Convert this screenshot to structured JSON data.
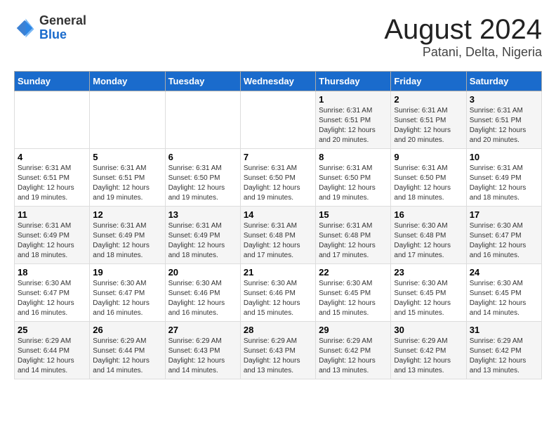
{
  "header": {
    "logo_general": "General",
    "logo_blue": "Blue",
    "main_title": "August 2024",
    "subtitle": "Patani, Delta, Nigeria"
  },
  "days_of_week": [
    "Sunday",
    "Monday",
    "Tuesday",
    "Wednesday",
    "Thursday",
    "Friday",
    "Saturday"
  ],
  "weeks": [
    [
      {
        "day": "",
        "info": ""
      },
      {
        "day": "",
        "info": ""
      },
      {
        "day": "",
        "info": ""
      },
      {
        "day": "",
        "info": ""
      },
      {
        "day": "1",
        "info": "Sunrise: 6:31 AM\nSunset: 6:51 PM\nDaylight: 12 hours\nand 20 minutes."
      },
      {
        "day": "2",
        "info": "Sunrise: 6:31 AM\nSunset: 6:51 PM\nDaylight: 12 hours\nand 20 minutes."
      },
      {
        "day": "3",
        "info": "Sunrise: 6:31 AM\nSunset: 6:51 PM\nDaylight: 12 hours\nand 20 minutes."
      }
    ],
    [
      {
        "day": "4",
        "info": "Sunrise: 6:31 AM\nSunset: 6:51 PM\nDaylight: 12 hours\nand 19 minutes."
      },
      {
        "day": "5",
        "info": "Sunrise: 6:31 AM\nSunset: 6:51 PM\nDaylight: 12 hours\nand 19 minutes."
      },
      {
        "day": "6",
        "info": "Sunrise: 6:31 AM\nSunset: 6:50 PM\nDaylight: 12 hours\nand 19 minutes."
      },
      {
        "day": "7",
        "info": "Sunrise: 6:31 AM\nSunset: 6:50 PM\nDaylight: 12 hours\nand 19 minutes."
      },
      {
        "day": "8",
        "info": "Sunrise: 6:31 AM\nSunset: 6:50 PM\nDaylight: 12 hours\nand 19 minutes."
      },
      {
        "day": "9",
        "info": "Sunrise: 6:31 AM\nSunset: 6:50 PM\nDaylight: 12 hours\nand 18 minutes."
      },
      {
        "day": "10",
        "info": "Sunrise: 6:31 AM\nSunset: 6:49 PM\nDaylight: 12 hours\nand 18 minutes."
      }
    ],
    [
      {
        "day": "11",
        "info": "Sunrise: 6:31 AM\nSunset: 6:49 PM\nDaylight: 12 hours\nand 18 minutes."
      },
      {
        "day": "12",
        "info": "Sunrise: 6:31 AM\nSunset: 6:49 PM\nDaylight: 12 hours\nand 18 minutes."
      },
      {
        "day": "13",
        "info": "Sunrise: 6:31 AM\nSunset: 6:49 PM\nDaylight: 12 hours\nand 18 minutes."
      },
      {
        "day": "14",
        "info": "Sunrise: 6:31 AM\nSunset: 6:48 PM\nDaylight: 12 hours\nand 17 minutes."
      },
      {
        "day": "15",
        "info": "Sunrise: 6:31 AM\nSunset: 6:48 PM\nDaylight: 12 hours\nand 17 minutes."
      },
      {
        "day": "16",
        "info": "Sunrise: 6:30 AM\nSunset: 6:48 PM\nDaylight: 12 hours\nand 17 minutes."
      },
      {
        "day": "17",
        "info": "Sunrise: 6:30 AM\nSunset: 6:47 PM\nDaylight: 12 hours\nand 16 minutes."
      }
    ],
    [
      {
        "day": "18",
        "info": "Sunrise: 6:30 AM\nSunset: 6:47 PM\nDaylight: 12 hours\nand 16 minutes."
      },
      {
        "day": "19",
        "info": "Sunrise: 6:30 AM\nSunset: 6:47 PM\nDaylight: 12 hours\nand 16 minutes."
      },
      {
        "day": "20",
        "info": "Sunrise: 6:30 AM\nSunset: 6:46 PM\nDaylight: 12 hours\nand 16 minutes."
      },
      {
        "day": "21",
        "info": "Sunrise: 6:30 AM\nSunset: 6:46 PM\nDaylight: 12 hours\nand 15 minutes."
      },
      {
        "day": "22",
        "info": "Sunrise: 6:30 AM\nSunset: 6:45 PM\nDaylight: 12 hours\nand 15 minutes."
      },
      {
        "day": "23",
        "info": "Sunrise: 6:30 AM\nSunset: 6:45 PM\nDaylight: 12 hours\nand 15 minutes."
      },
      {
        "day": "24",
        "info": "Sunrise: 6:30 AM\nSunset: 6:45 PM\nDaylight: 12 hours\nand 14 minutes."
      }
    ],
    [
      {
        "day": "25",
        "info": "Sunrise: 6:29 AM\nSunset: 6:44 PM\nDaylight: 12 hours\nand 14 minutes."
      },
      {
        "day": "26",
        "info": "Sunrise: 6:29 AM\nSunset: 6:44 PM\nDaylight: 12 hours\nand 14 minutes."
      },
      {
        "day": "27",
        "info": "Sunrise: 6:29 AM\nSunset: 6:43 PM\nDaylight: 12 hours\nand 14 minutes."
      },
      {
        "day": "28",
        "info": "Sunrise: 6:29 AM\nSunset: 6:43 PM\nDaylight: 12 hours\nand 13 minutes."
      },
      {
        "day": "29",
        "info": "Sunrise: 6:29 AM\nSunset: 6:42 PM\nDaylight: 12 hours\nand 13 minutes."
      },
      {
        "day": "30",
        "info": "Sunrise: 6:29 AM\nSunset: 6:42 PM\nDaylight: 12 hours\nand 13 minutes."
      },
      {
        "day": "31",
        "info": "Sunrise: 6:29 AM\nSunset: 6:42 PM\nDaylight: 12 hours\nand 13 minutes."
      }
    ]
  ]
}
